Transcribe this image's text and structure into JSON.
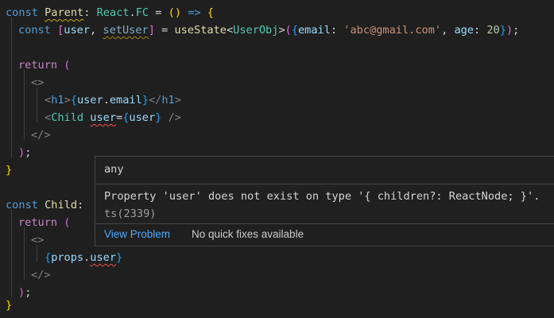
{
  "code": {
    "l1": {
      "kw_const": "const",
      "name": "Parent",
      "colon": ":",
      "type_ns": "React",
      "dot": ".",
      "type_fc": "FC",
      "eq": " = ",
      "paren_open": "(",
      "paren_close": ")",
      "arrow": " => ",
      "brace": "{"
    },
    "l2": {
      "kw_const": "const",
      "bracket_open": "[",
      "var_user": "user",
      "comma": ", ",
      "var_setter": "setUser",
      "bracket_close": "]",
      "eq": " = ",
      "fn": "useState",
      "lt": "<",
      "type": "UserObj",
      "gt": ">",
      "paren_open": "(",
      "obj_open": "{",
      "key_email": "email",
      "colon1": ": ",
      "str_email": "'abc@gmail.com'",
      "comma2": ", ",
      "key_age": "age",
      "colon2": ": ",
      "num_age": "20",
      "obj_close": "}",
      "paren_close": ")",
      "semi": ";"
    },
    "l4": {
      "kw_return": "return",
      "paren": "("
    },
    "l5": {
      "frag_open": "<>"
    },
    "l6": {
      "lt": "<",
      "tag": "h1",
      "gt": ">",
      "expr_open": "{",
      "obj": "user",
      "dot": ".",
      "prop": "email",
      "expr_close": "}",
      "close_lt": "</",
      "close_tag": "h1",
      "close_gt": ">"
    },
    "l7": {
      "lt": "<",
      "component": "Child",
      "attr": "user",
      "eq": "=",
      "expr_open": "{",
      "val": "user",
      "expr_close": "}",
      "self_close": " />"
    },
    "l8": {
      "frag_close": "</>"
    },
    "l9": {
      "paren": ")",
      "semi": ";"
    },
    "l10": {
      "brace": "}"
    },
    "l12": {
      "kw_const": "const",
      "name": "Child",
      "colon": ":"
    },
    "l13": {
      "kw_return": "return",
      "paren": "("
    },
    "l14": {
      "frag_open": "<>"
    },
    "l15": {
      "expr_open": "{",
      "obj": "props",
      "dot": ".",
      "prop": "user",
      "expr_close": "}"
    },
    "l16": {
      "frag_close": "</>"
    },
    "l17": {
      "paren": ")",
      "semi": ";"
    },
    "l18": {
      "brace": "}"
    }
  },
  "hover": {
    "signature": "any",
    "message": "Property 'user' does not exist on type '{ children?: ReactNode; }'.",
    "code": "ts(2339)",
    "view_problem": "View Problem",
    "no_quick_fixes": "No quick fixes available"
  },
  "colors": {
    "background": "#1f1f1f",
    "keyword": "#569cd6",
    "variable": "#9cdcfe",
    "function": "#dcdcaa",
    "type": "#4ec9b0",
    "string": "#ce9178",
    "number": "#b5cea8",
    "error_squiggle": "#f14c4c",
    "warning_squiggle": "#cca700",
    "link": "#4daafc"
  }
}
